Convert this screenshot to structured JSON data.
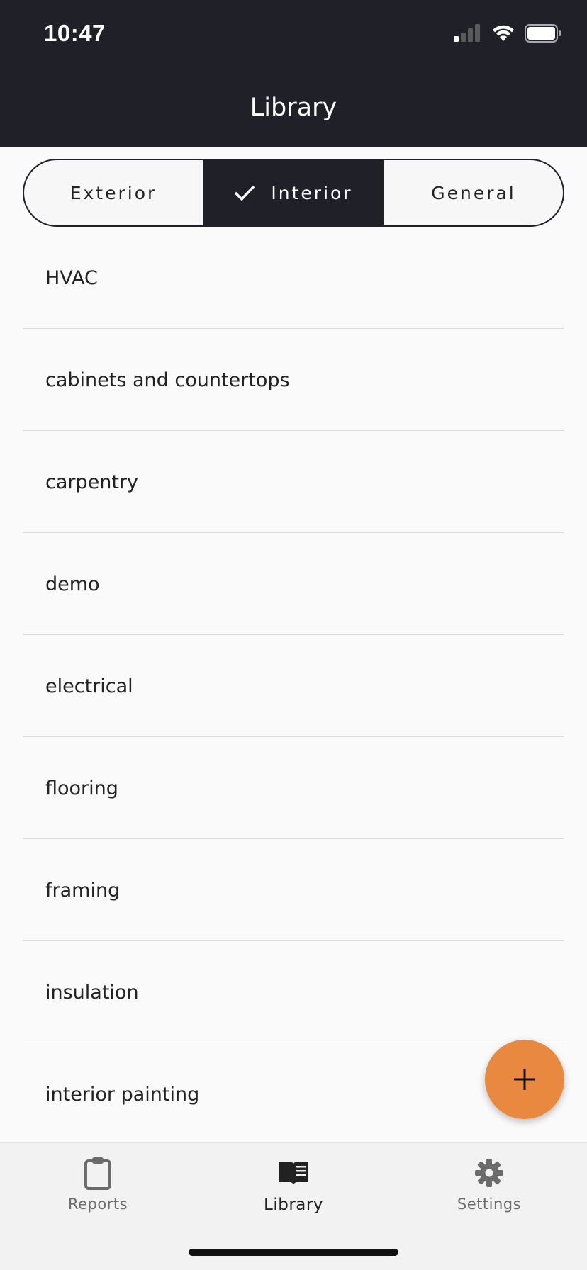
{
  "status_bar": {
    "time": "10:47"
  },
  "header": {
    "title": "Library"
  },
  "segments": [
    {
      "label": "Exterior",
      "active": false
    },
    {
      "label": "Interior",
      "active": true
    },
    {
      "label": "General",
      "active": false
    }
  ],
  "list": [
    "HVAC",
    "cabinets and countertops",
    "carpentry",
    "demo",
    "electrical",
    "flooring",
    "framing",
    "insulation",
    "interior painting"
  ],
  "fab": {
    "icon": "plus-icon",
    "color": "#e8893f"
  },
  "tabbar": {
    "tabs": [
      {
        "label": "Reports",
        "icon": "clipboard-icon",
        "active": false
      },
      {
        "label": "Library",
        "icon": "book-icon",
        "active": true
      },
      {
        "label": "Settings",
        "icon": "gear-icon",
        "active": false
      }
    ]
  },
  "colors": {
    "header_bg": "#1f2028",
    "accent": "#e8893f"
  }
}
